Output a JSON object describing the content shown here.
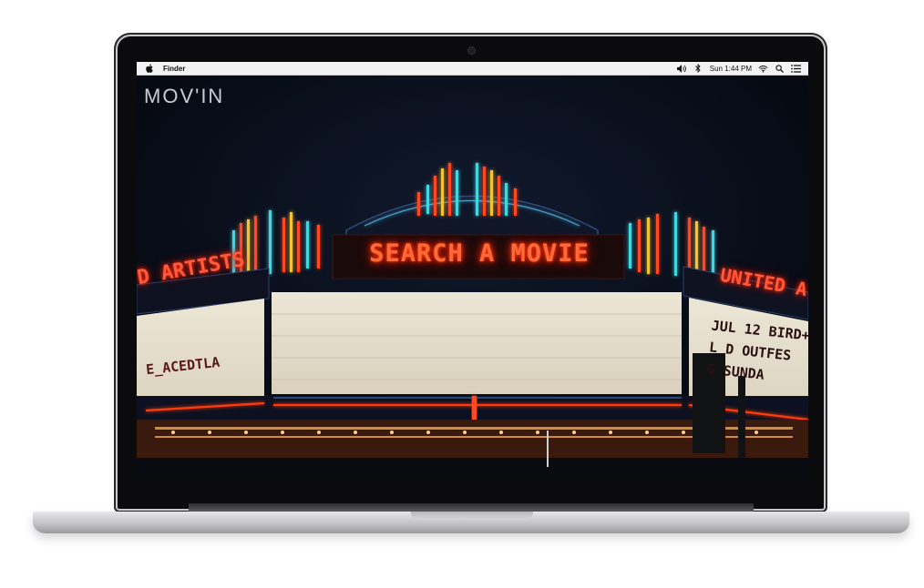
{
  "menubar": {
    "app_name": "Finder",
    "clock": "Sun 1:44 PM",
    "icons": [
      "apple-icon",
      "volume-icon",
      "bluetooth-icon",
      "wifi-icon",
      "spotlight-icon",
      "notification-center-icon"
    ]
  },
  "site": {
    "logo": "MOV'IN",
    "marquee_sign": "SEARCH A MOVIE",
    "neon_left": "D ARTISTS",
    "neon_right": "UNITED A",
    "board_left": "E_ACEDTLA",
    "board_right_lines": [
      "JUL 12 BIRD+",
      "L  D OUTFES",
      "G     SUNDA"
    ]
  },
  "colors": {
    "neon_red": "#ff3a10",
    "neon_cyan": "#43d6e0",
    "neon_yellow": "#f4c430",
    "night_sky": "#070a14",
    "board_cream": "#e9e3d4"
  }
}
